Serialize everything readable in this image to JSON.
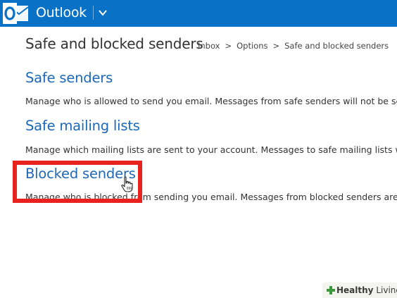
{
  "app": {
    "title": "Outlook",
    "brand_color": "#0a72c6"
  },
  "header": {
    "logo_icon": "outlook-logo-icon",
    "menu_icon": "chevron-down-icon"
  },
  "page": {
    "title": "Safe and blocked senders",
    "breadcrumb": [
      "Inbox",
      "Options",
      "Safe and blocked senders"
    ]
  },
  "sections": [
    {
      "title": "Safe senders",
      "description": "Manage who is allowed to send you email. Messages from safe senders will not be sent"
    },
    {
      "title": "Safe mailing lists",
      "description": "Manage which mailing lists are sent to your account. Messages to safe mailing lists will"
    },
    {
      "title": "Blocked senders",
      "description": "Manage who is blocked from sending you email. Messages from blocked senders are a"
    }
  ],
  "annotation": {
    "highlight_color": "#e8231e",
    "cursor_icon": "hand-pointer-icon"
  },
  "watermark": {
    "word1": "Healthy",
    "word2": "Living"
  }
}
